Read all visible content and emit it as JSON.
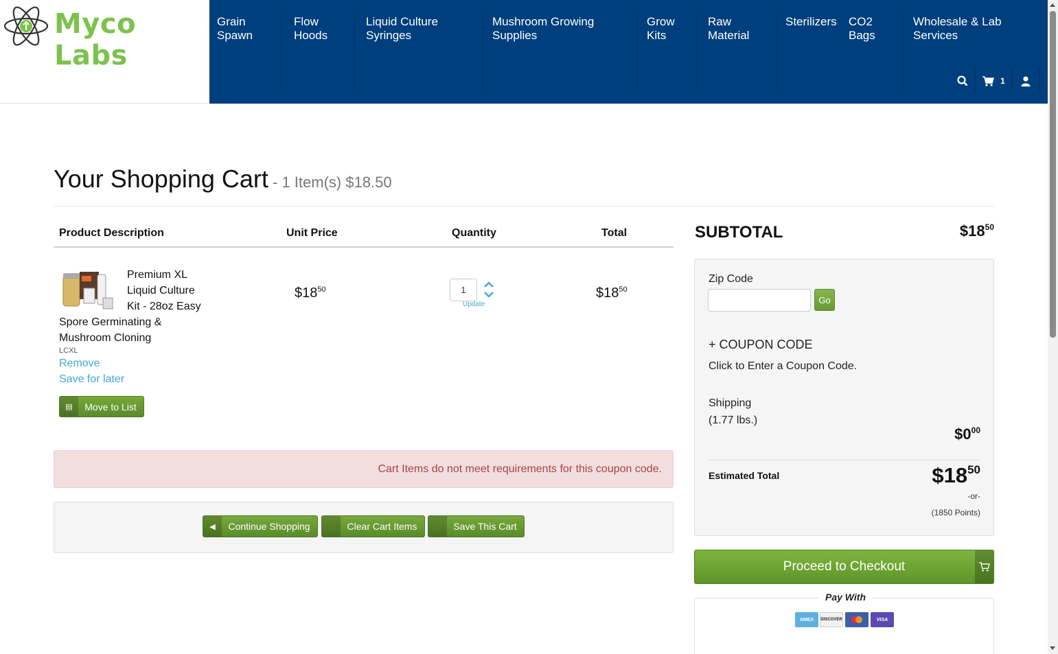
{
  "brand": {
    "name": "Myco Labs",
    "color": "#7cc24c"
  },
  "nav": {
    "items": [
      {
        "label": "Grain\nSpawn"
      },
      {
        "label": "Flow\nHoods"
      },
      {
        "label": "Liquid Culture\nSyringes"
      },
      {
        "label": "Mushroom Growing\nSupplies"
      },
      {
        "label": "Grow\nKits"
      },
      {
        "label": "Raw\nMaterial"
      },
      {
        "label": "Sterilizers"
      },
      {
        "label": "CO2\nBags"
      },
      {
        "label": "Wholesale & Lab\nServices"
      }
    ],
    "cart_count": "1",
    "icons": [
      "search-icon",
      "cart-icon",
      "user-icon"
    ],
    "background": "#003f7d"
  },
  "page": {
    "title": "Your Shopping Cart",
    "summary": " - 1 Item(s) $18.50"
  },
  "table": {
    "headers": {
      "product": "Product Description",
      "unit_price": "Unit Price",
      "quantity": "Quantity",
      "total": "Total"
    },
    "item": {
      "name": "Premium XL Liquid Culture Kit - 28oz Easy Spore Germinating & Mushroom Cloning",
      "sku": "LCXL",
      "remove": "Remove",
      "save_later": "Save for later",
      "move_to_list": "Move to List",
      "unit_price_dollars": "$18",
      "unit_price_cents": "50",
      "quantity": "1",
      "update": "Update",
      "total_dollars": "$18",
      "total_cents": "50"
    }
  },
  "alert": {
    "message": "Cart Items do not meet requirements for this coupon code."
  },
  "actions": {
    "continue": "Continue Shopping",
    "clear": "Clear Cart Items",
    "save": "Save This Cart"
  },
  "sidebar": {
    "subtotal_label": "SUBTOTAL",
    "subtotal_dollars": "$18",
    "subtotal_cents": "50",
    "zip_label": "Zip Code",
    "zip_value": "",
    "go": "Go",
    "coupon_title": "+ COUPON CODE",
    "coupon_sub": "Click to Enter a Coupon Code.",
    "shipping_label": "Shipping",
    "shipping_weight": "(1.77 lbs.)",
    "shipping_dollars": "$0",
    "shipping_cents": "00",
    "est_label": "Estimated Total",
    "est_dollars": "$18",
    "est_cents": "50",
    "or": "-or-",
    "points": "(1850 Points)",
    "checkout": "Proceed to Checkout",
    "pay_with": "Pay With",
    "cards": [
      "AMEX",
      "DISCOVER",
      "MASTERCARD",
      "VISA"
    ]
  }
}
